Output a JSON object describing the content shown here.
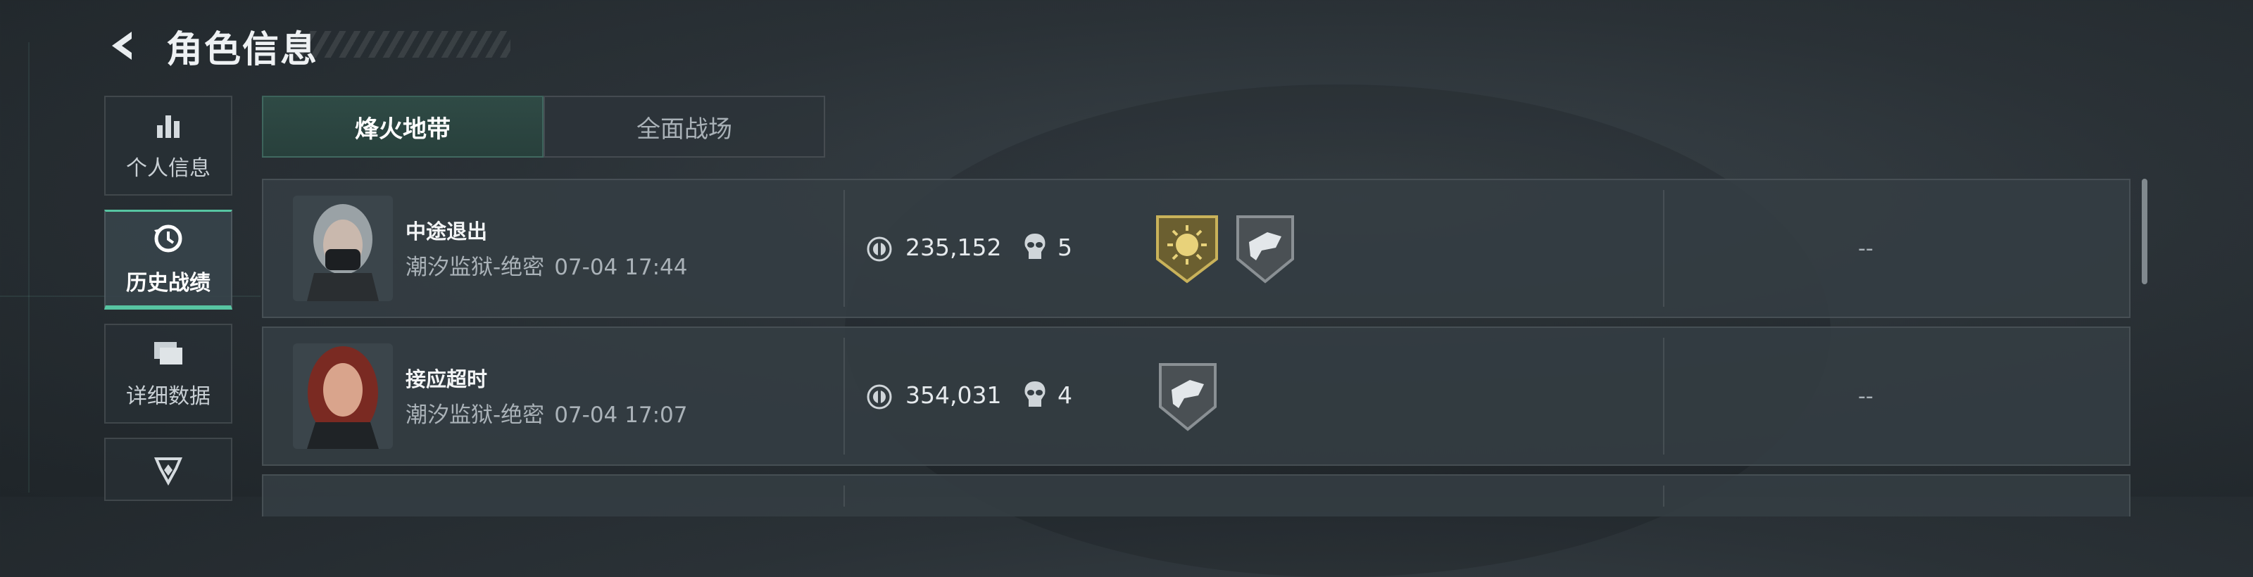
{
  "header": {
    "title": "角色信息",
    "back_icon": "back-arrow-icon"
  },
  "sidebar": {
    "items": [
      {
        "label": "个人信息",
        "icon": "bar-chart-icon",
        "active": false
      },
      {
        "label": "历史战绩",
        "icon": "clock-history-icon",
        "active": true
      },
      {
        "label": "详细数据",
        "icon": "folders-icon",
        "active": false
      },
      {
        "label": "",
        "icon": "emblem-icon",
        "active": false
      }
    ]
  },
  "tabs": [
    {
      "label": "烽火地带",
      "active": true
    },
    {
      "label": "全面战场",
      "active": false
    }
  ],
  "matches": [
    {
      "result": "中途退出",
      "map": "潮汐监狱-绝密",
      "time": "07-04 17:44",
      "money": "235,152",
      "kills": "5",
      "badges": [
        "gold-sun-badge-icon",
        "gray-weapon-badge-icon"
      ],
      "extra": "--"
    },
    {
      "result": "接应超时",
      "map": "潮汐监狱-绝密",
      "time": "07-04 17:07",
      "money": "354,031",
      "kills": "4",
      "badges": [
        "gray-weapon-badge-icon"
      ],
      "extra": "--"
    }
  ],
  "colors": {
    "accent": "#57c5a2",
    "panel": "#343d43",
    "gold": "#c9b25a"
  }
}
